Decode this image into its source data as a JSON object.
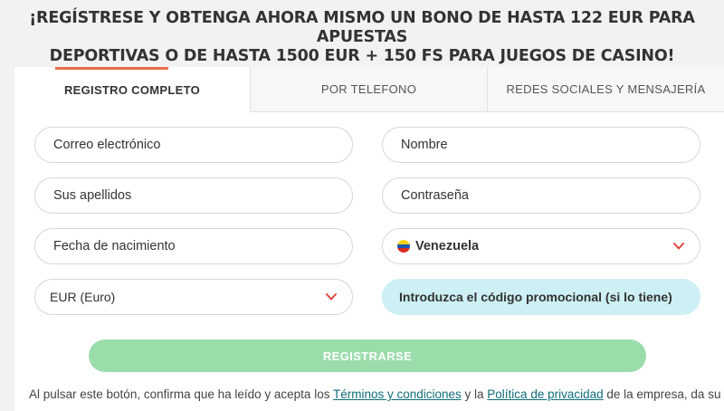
{
  "headline": {
    "line1": "¡REGÍSTRESE Y OBTENGA AHORA MISMO UN BONO DE HASTA 122 EUR PARA APUESTAS",
    "line2": "DEPORTIVAS O DE HASTA 1500 EUR + 150 FS PARA JUEGOS DE CASINO!"
  },
  "tabs": [
    {
      "label": "REGISTRO COMPLETO",
      "active": true
    },
    {
      "label": "POR TELEFONO",
      "active": false
    },
    {
      "label": "REDES SOCIALES Y MENSAJERÍA",
      "active": false
    }
  ],
  "form": {
    "email": "Correo electrónico",
    "name": "Nombre",
    "surname": "Sus apellidos",
    "password": "Contraseña",
    "birthdate": "Fecha de nacimiento",
    "country": "Venezuela",
    "currency": "EUR (Euro)",
    "promo": "Introduzca el código promocional (si lo tiene)"
  },
  "register_label": "REGISTRARSE",
  "legal": {
    "prefix": "Al pulsar este botón, confirma que ha leído y acepta los ",
    "terms_link": "Términos y condiciones",
    "middle": " y la ",
    "privacy_link": "Política de privacidad",
    "suffix": " de la empresa, da su"
  },
  "colors": {
    "tab_indicator": "#e86c52",
    "register_button": "#9bdcab",
    "promo_field": "#cdf0f4",
    "link": "#0f6d7a",
    "chevron": "#e0473a"
  }
}
